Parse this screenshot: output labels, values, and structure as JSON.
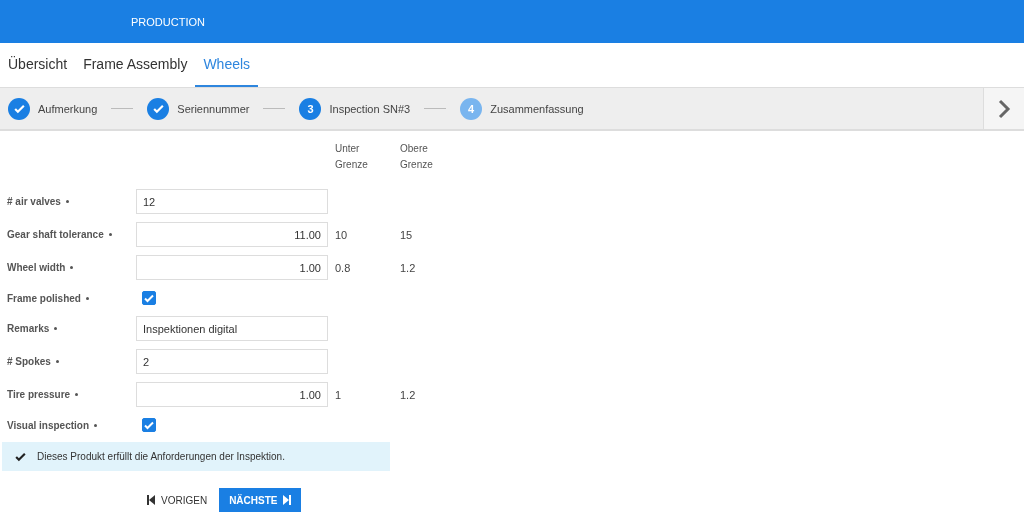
{
  "header": {
    "title": "PRODUCTION"
  },
  "tabs": [
    {
      "label": "Übersicht",
      "selected": false
    },
    {
      "label": "Frame Assembly",
      "selected": false
    },
    {
      "label": "Wheels",
      "selected": true
    }
  ],
  "steps": [
    {
      "label": "Aufmerkung",
      "kind": "done"
    },
    {
      "label": "Seriennummer",
      "kind": "done"
    },
    {
      "label": "Inspection SN#3",
      "kind": "active",
      "number": "3"
    },
    {
      "label": "Zusammenfassung",
      "kind": "pending",
      "number": "4"
    }
  ],
  "limit_headers": {
    "lower": "Unter Grenze",
    "upper": "Obere Grenze"
  },
  "rows": [
    {
      "kind": "text",
      "label": "# air valves",
      "required": true,
      "value": "12"
    },
    {
      "kind": "number",
      "label": "Gear shaft tolerance",
      "required": true,
      "value": "11.00",
      "lower": "10",
      "upper": "15"
    },
    {
      "kind": "number",
      "label": "Wheel width",
      "required": true,
      "value": "1.00",
      "lower": "0.8",
      "upper": "1.2"
    },
    {
      "kind": "checkbox",
      "label": "Frame polished",
      "required": true,
      "checked": true
    },
    {
      "kind": "text",
      "label": "Remarks",
      "required": true,
      "value": "Inspektionen digital"
    },
    {
      "kind": "text",
      "label": "# Spokes",
      "required": true,
      "value": "2"
    },
    {
      "kind": "number",
      "label": "Tire pressure",
      "required": true,
      "value": "1.00",
      "lower": "1",
      "upper": "1.2"
    },
    {
      "kind": "checkbox",
      "label": "Visual inspection",
      "required": true,
      "checked": true
    }
  ],
  "message": "Dieses Produkt erfüllt die Anforderungen der Inspektion.",
  "buttons": {
    "previous": "VORIGEN",
    "next": "NÄCHSTE"
  }
}
